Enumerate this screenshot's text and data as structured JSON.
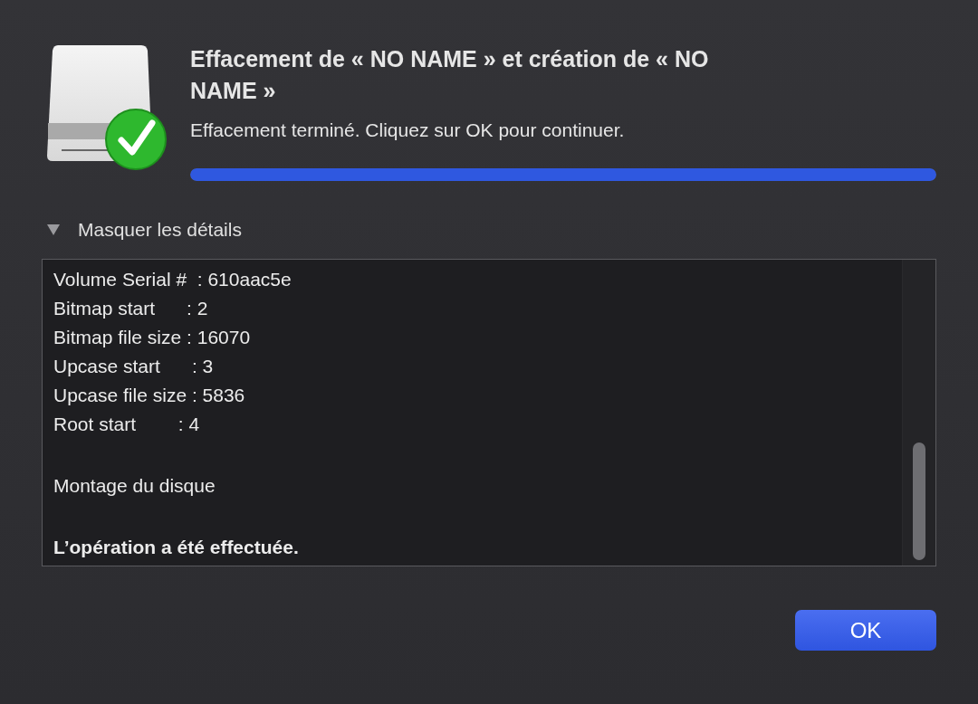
{
  "title": "Effacement de « NO NAME » et création de « NO NAME »",
  "status": "Effacement terminé. Cliquez sur OK pour continuer.",
  "progress": {
    "level": 1.0
  },
  "details_toggle": {
    "label": "Masquer les détails",
    "expanded": true
  },
  "log_blocks": [
    {
      "kind": "plain",
      "lines": [
        "Volume Serial #  : 610aac5e",
        "Bitmap start      : 2",
        "Bitmap file size : 16070",
        "Upcase start      : 3",
        "Upcase file size : 5836",
        "Root start        : 4"
      ]
    },
    {
      "kind": "plain",
      "lines": [
        "Montage du disque"
      ]
    },
    {
      "kind": "bold",
      "lines": [
        "L’opération a été effectuée."
      ]
    }
  ],
  "buttons": [
    {
      "label": "OK",
      "default": true
    }
  ]
}
